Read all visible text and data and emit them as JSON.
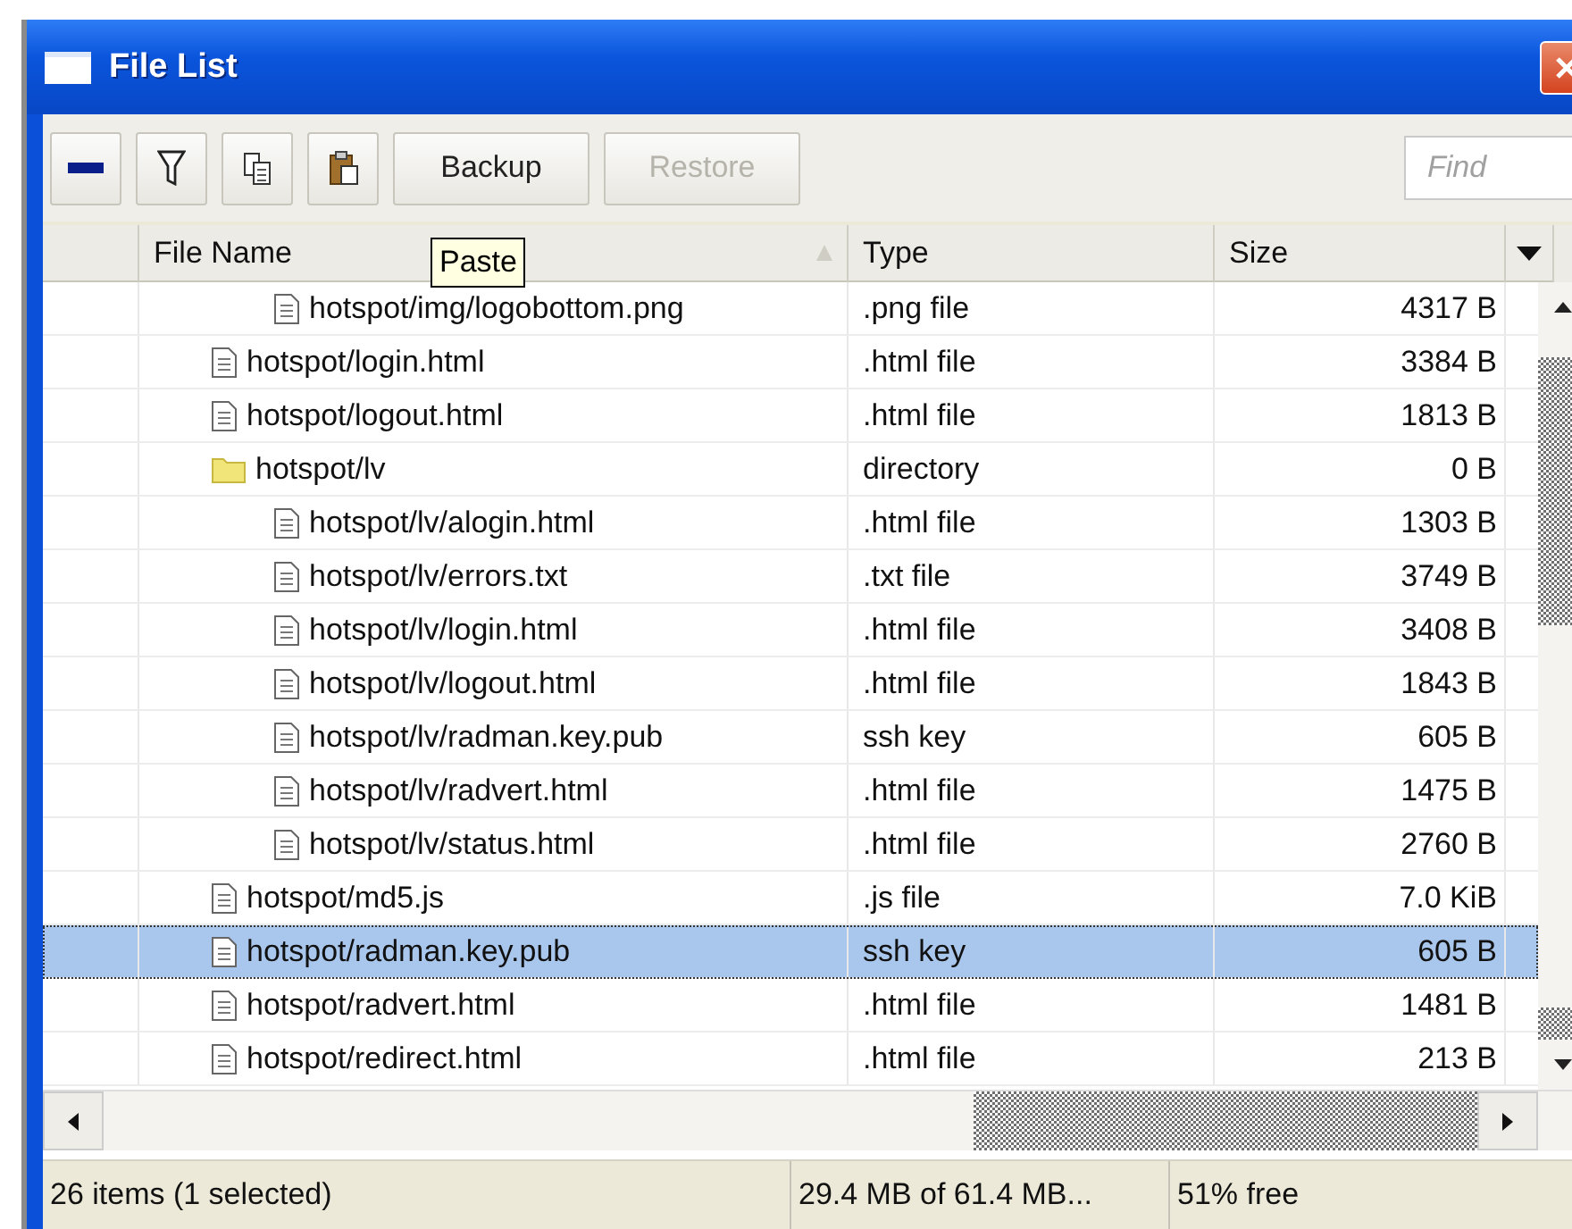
{
  "window": {
    "title": "File List"
  },
  "toolbar": {
    "buttons": [
      {
        "label": "Backup",
        "disabled": false
      },
      {
        "label": "Restore",
        "disabled": true
      }
    ],
    "search": {
      "placeholder": "Find"
    }
  },
  "tooltip": "Paste",
  "table": {
    "columns": [
      {
        "label": "File Name",
        "sorted": true
      },
      {
        "label": "Type",
        "sorted": false
      },
      {
        "label": "Size",
        "sorted": false
      }
    ],
    "rows": [
      {
        "children": [
          {
            "name": "hotspot/img/logobottom.png",
            "kind": "file",
            "type": ".png file",
            "size": "4317 B",
            "selected": false
          }
        ]
      },
      {
        "name": "hotspot/login.html",
        "kind": "file",
        "type": ".html file",
        "size": "3384 B",
        "selected": false
      },
      {
        "name": "hotspot/logout.html",
        "kind": "file",
        "type": ".html file",
        "size": "1813 B",
        "selected": false
      },
      {
        "name": "hotspot/lv",
        "kind": "directory",
        "type": "directory",
        "size": "0 B",
        "selected": false,
        "children": [
          {
            "name": "hotspot/lv/alogin.html",
            "kind": "file",
            "type": ".html file",
            "size": "1303 B",
            "selected": false
          },
          {
            "name": "hotspot/lv/errors.txt",
            "kind": "file",
            "type": ".txt file",
            "size": "3749 B",
            "selected": false
          },
          {
            "name": "hotspot/lv/login.html",
            "kind": "file",
            "type": ".html file",
            "size": "3408 B",
            "selected": false
          },
          {
            "name": "hotspot/lv/logout.html",
            "kind": "file",
            "type": ".html file",
            "size": "1843 B",
            "selected": false
          },
          {
            "name": "hotspot/lv/radman.key.pub",
            "kind": "file",
            "type": "ssh key",
            "size": "605 B",
            "selected": false
          },
          {
            "name": "hotspot/lv/radvert.html",
            "kind": "file",
            "type": ".html file",
            "size": "1475 B",
            "selected": false
          },
          {
            "name": "hotspot/lv/status.html",
            "kind": "file",
            "type": ".html file",
            "size": "2760 B",
            "selected": false
          }
        ]
      },
      {
        "name": "hotspot/md5.js",
        "kind": "file",
        "type": ".js file",
        "size": "7.0 KiB",
        "selected": false
      },
      {
        "name": "hotspot/radman.key.pub",
        "kind": "file",
        "type": "ssh key",
        "size": "605 B",
        "selected": true
      },
      {
        "name": "hotspot/radvert.html",
        "kind": "file",
        "type": ".html file",
        "size": "1481 B",
        "selected": false
      },
      {
        "name": "hotspot/redirect.html",
        "kind": "file",
        "type": ".html file",
        "size": "213 B",
        "selected": false
      }
    ]
  },
  "status_bar": [
    "26 items (1 selected)",
    "29.4 MB of 61.4 MB...",
    "51% free"
  ]
}
